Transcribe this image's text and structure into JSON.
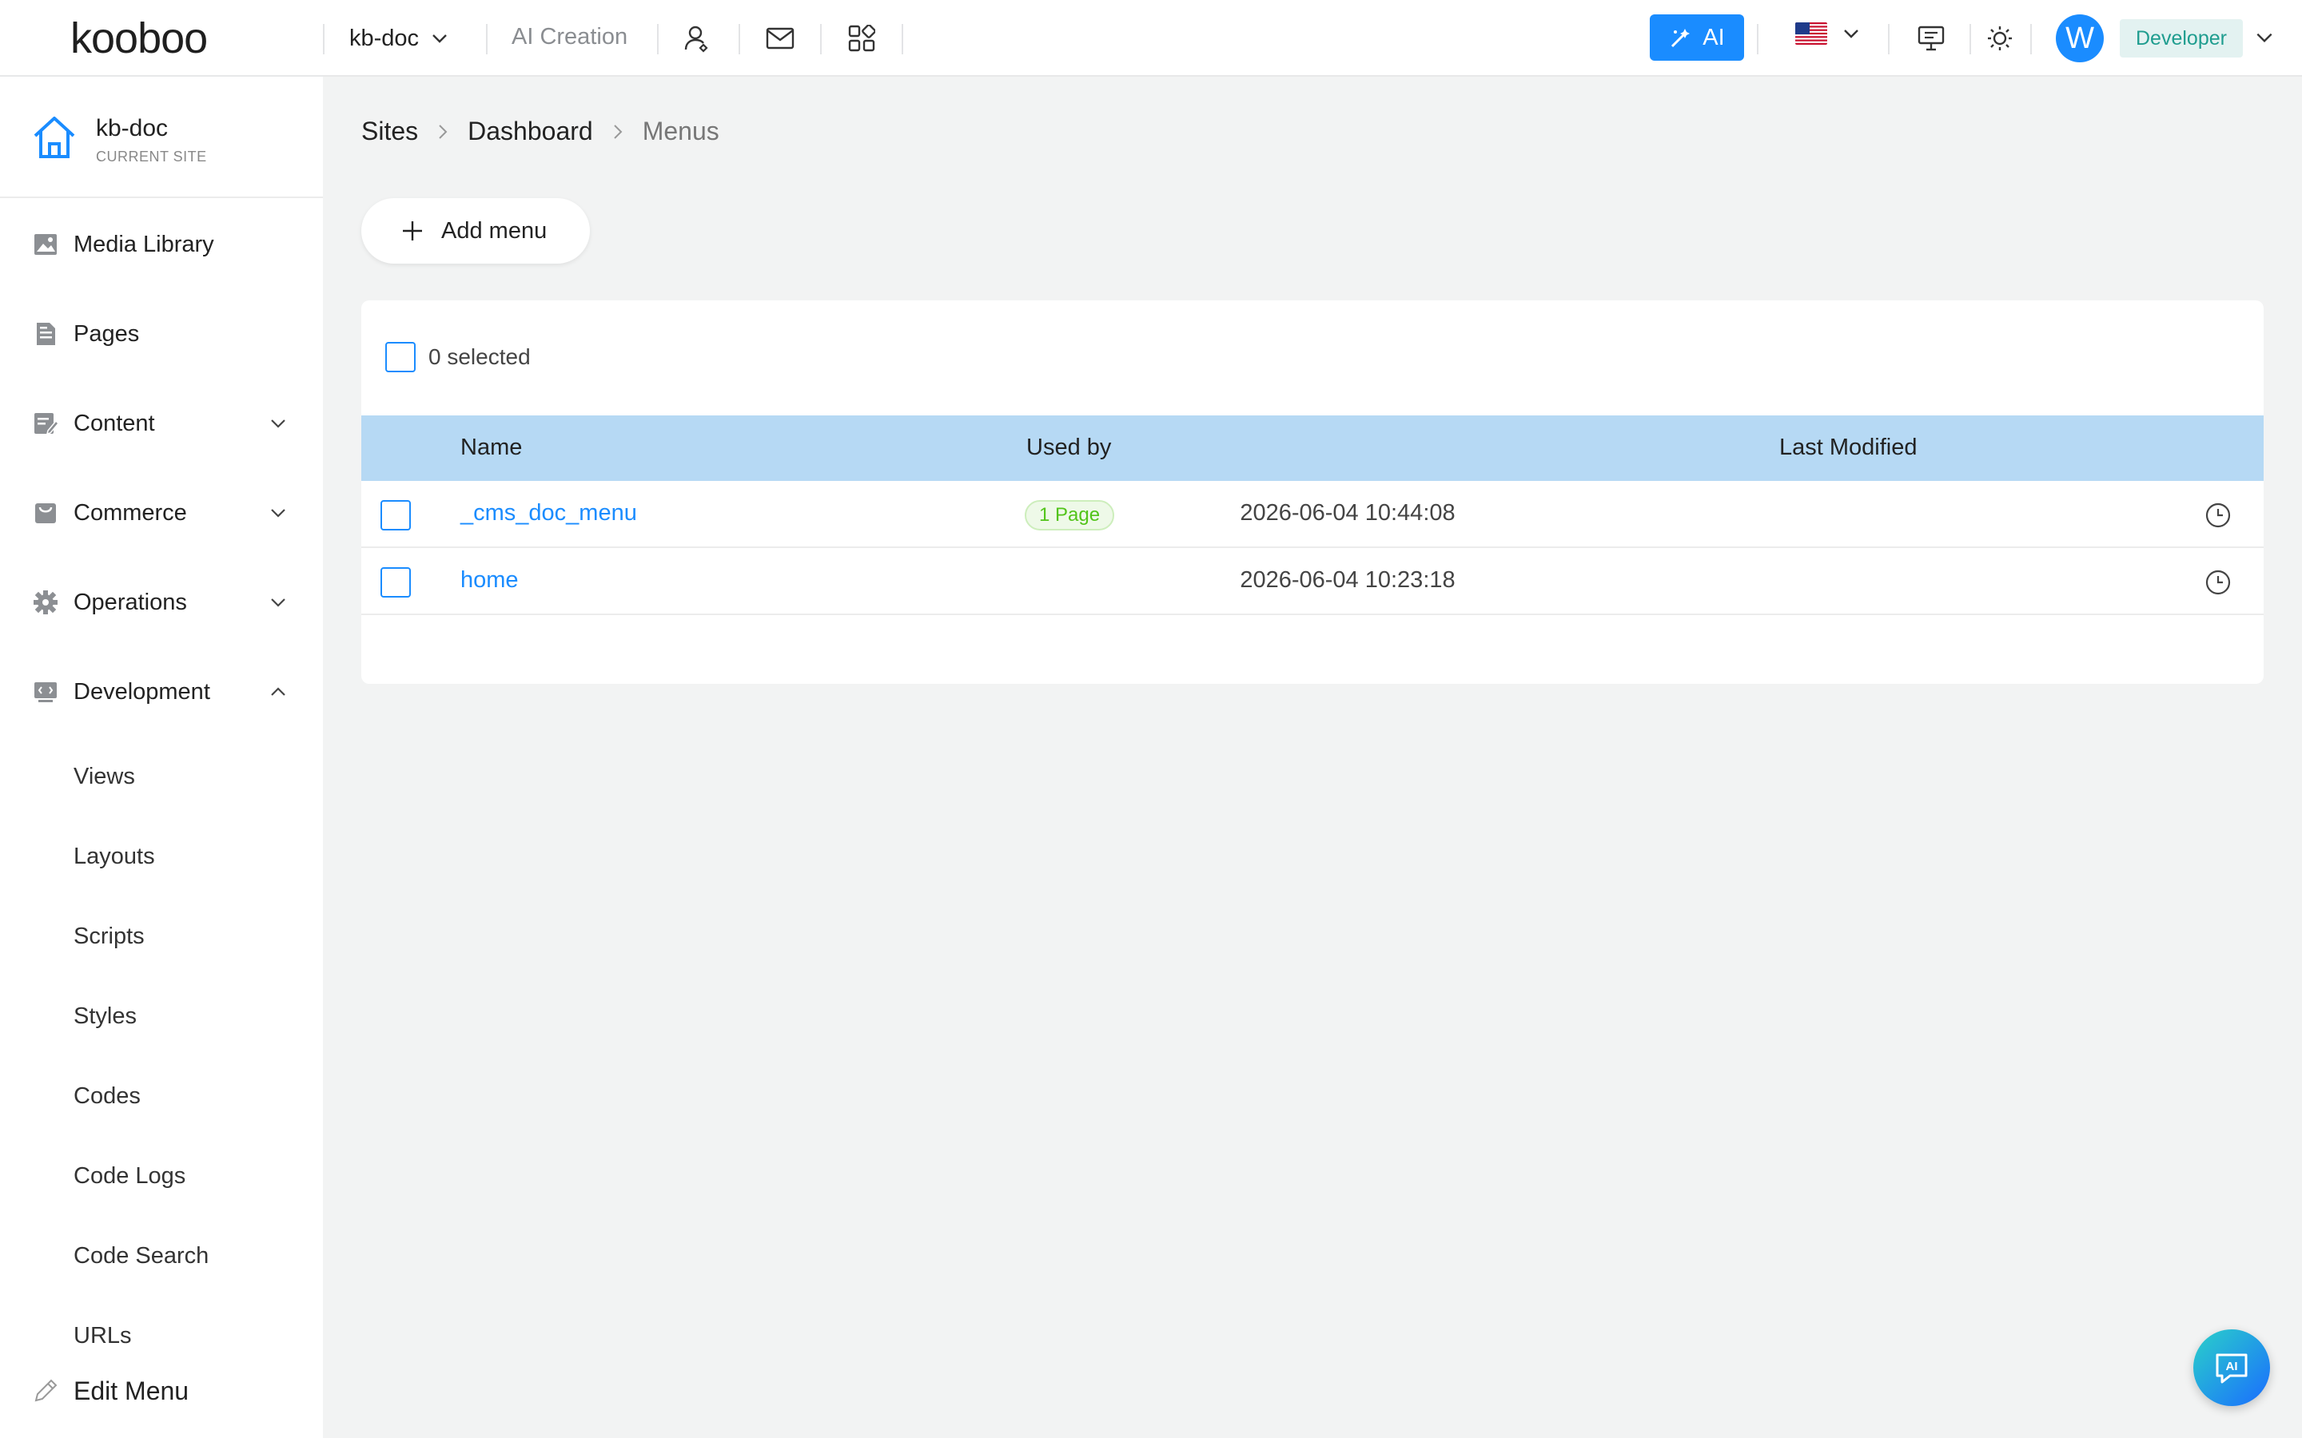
{
  "header": {
    "logo_text": "kooboo",
    "site_name": "kb-doc",
    "ai_creation": "AI Creation",
    "ai_button": "AI",
    "language_flag": "us-flag",
    "avatar_letter": "W",
    "role": "Developer"
  },
  "sidebar": {
    "current_site": {
      "name": "kb-doc",
      "caption": "CURRENT SITE"
    },
    "items": [
      {
        "label": "Media Library",
        "icon": "image-icon"
      },
      {
        "label": "Pages",
        "icon": "page-icon"
      },
      {
        "label": "Content",
        "icon": "content-icon",
        "expandable": true
      },
      {
        "label": "Commerce",
        "icon": "commerce-icon",
        "expandable": true
      },
      {
        "label": "Operations",
        "icon": "gear-icon",
        "expandable": true
      },
      {
        "label": "Development",
        "icon": "code-icon",
        "expandable": true,
        "expanded": true
      }
    ],
    "development_children": [
      "Views",
      "Layouts",
      "Scripts",
      "Styles",
      "Codes",
      "Code Logs",
      "Code Search",
      "URLs"
    ],
    "edit_menu": "Edit Menu"
  },
  "breadcrumb": [
    "Sites",
    "Dashboard",
    "Menus"
  ],
  "main": {
    "add_button": "Add menu",
    "selected_text": "0 selected",
    "columns": [
      "Name",
      "Used by",
      "Last Modified"
    ],
    "rows": [
      {
        "name": "_cms_doc_menu",
        "used_by": "1 Page",
        "last_modified": "2026-06-04 10:44:08"
      },
      {
        "name": "home",
        "used_by": "",
        "last_modified": "2026-06-04 10:23:18"
      }
    ]
  },
  "colors": {
    "accent": "#1a8cff",
    "table_header": "#b6d9f4",
    "badge_green": "#52c41a",
    "role_bg": "#e3f2f1",
    "role_text": "#1f9d8f"
  }
}
